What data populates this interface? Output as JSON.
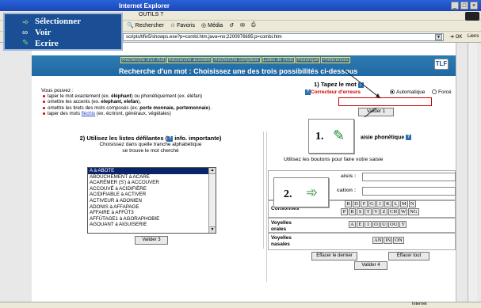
{
  "browser": {
    "title": "Internet Explorer",
    "menu_label": "OUTILS  ?",
    "toolbar": {
      "rechercher": "Rechercher",
      "favoris": "Favoris",
      "media": "Média"
    },
    "address": "scripts/tlfiv5/showps.exe?p=combi.htm;java=no;2200976695;p=combi.htm",
    "go_label": "OK",
    "liens_label": "Liens",
    "status_text": "Internet"
  },
  "legend": {
    "items": [
      {
        "label": "Sélectionner",
        "icon": "pointer-icon"
      },
      {
        "label": "Voir",
        "icon": "eye-icon"
      },
      {
        "label": "Ecrire",
        "icon": "pencil-icon"
      }
    ]
  },
  "site": {
    "nav": [
      "Recherche d'un mot",
      "Recherche assistée",
      "Recherche complexe",
      "Listes de mots",
      "Historique",
      "Préférences"
    ],
    "title": "Recherche d'un mot : Choisissez une des trois possibilités ci-dessous",
    "logo": "TLF"
  },
  "section1": {
    "title": "1) Tapez le mot",
    "intro": "Vous pouvez :",
    "bullets": [
      {
        "pre": "taper le mot exactement (ex. ",
        "bold": "éléphant",
        "post": ") ou phonétiquement (ex. éléfan)"
      },
      {
        "pre": "omettre les accents (ex. ",
        "bold": "elephant, elefan",
        "post": "),"
      },
      {
        "pre": "omettre les tirets des mots composés (ex. ",
        "bold": "porte monnaie, portemonnaie",
        "post": ")."
      },
      {
        "pre": "taper des mots ",
        "link": "fléchis",
        "post": " (ex. écriront, généraux, végétales)"
      }
    ],
    "corrector_label": "Correcteur d'erreurs",
    "radio_auto": "Automatique",
    "radio_force": "Forcé",
    "input_value": "",
    "valider_label": "Valider 1"
  },
  "section2": {
    "title": "2) Utilisez les listes défilantes",
    "title_suffix": "info. importante)",
    "subtitle_line1": "Choisissez dans quelle tranche alphabétique",
    "subtitle_line2": "se trouve le mot cherché",
    "list": [
      "A à ABOTE",
      "ABOUCHEMENT à ACARÉ",
      "ACARÉMER (S') à ACCOUVER",
      "ACCOUVÉ à ACIDIFIÈRE",
      "ACIDIFIABLE à ACTIVER",
      "ACTIVEUR à ADONIEN",
      "ADONIS à AFFAPAGE",
      "AFFAIRE à AFFÛT3",
      "AFFÛTAGE1 à AGORAPHOBIE",
      "AGOUANT à AIGUISERIE"
    ],
    "selected_index": 0,
    "valider_label": "Valider 3"
  },
  "section3": {
    "title": "aisie phonétique",
    "subtitle": "Utilisez les boutons pour faire votre saisie",
    "saisis_label": "aisis :",
    "cation_label": "cation :",
    "consonnes_label": "Consonnes",
    "voyelles_orales_line1": "Voyelles",
    "voyelles_orales_line2": "orales",
    "voyelles_nasales_line1": "Voyelles",
    "voyelles_nasales_line2": "nasales",
    "consonnes_row1": [
      "B",
      "D",
      "F",
      "G",
      "J",
      "K",
      "L",
      "M",
      "N"
    ],
    "consonnes_row2": [
      "P",
      "R",
      "S",
      "T",
      "V",
      "Z",
      "CH",
      "W",
      "NG"
    ],
    "voyelles_orales": [
      "A",
      "E",
      "I",
      "O",
      "U",
      "OU",
      "Y"
    ],
    "voyelles_nasales": [
      "AN",
      "IN",
      "ON"
    ],
    "effacer_dernier": "Effacer le dernier",
    "effacer_tout": "Effacer tout",
    "valider_label": "Valider 4"
  },
  "badges": [
    {
      "number": "1.",
      "icon": "pencil-icon"
    },
    {
      "number": "2.",
      "icon": "pointer-icon"
    }
  ],
  "colors": {
    "accent": "#1a4f95",
    "error": "#cc0000",
    "header": "#2068a4",
    "link": "#2244cc"
  }
}
